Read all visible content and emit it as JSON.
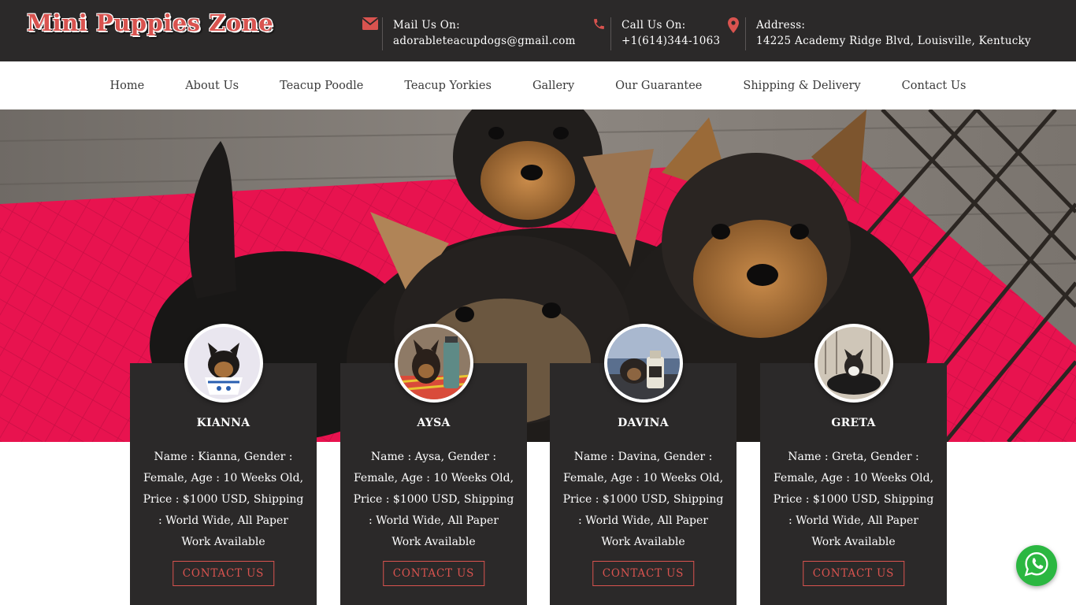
{
  "header": {
    "logo": "Mini Puppies Zone",
    "mail": {
      "label": "Mail Us On:",
      "value": "adorableteacupdogs@gmail.com",
      "icon": "envelope-icon"
    },
    "phone": {
      "label": "Call Us On:",
      "value": "+1(614)344-1063",
      "icon": "phone-icon"
    },
    "address": {
      "label": "Address:",
      "value": "14225 Academy Ridge Blvd, Louisville, Kentucky",
      "icon": "map-marker-icon"
    }
  },
  "nav": {
    "items": [
      "Home",
      "About Us",
      "Teacup Poodle",
      "Teacup Yorkies",
      "Gallery",
      "Our Guarantee",
      "Shipping & Delivery",
      "Contact Us"
    ]
  },
  "cards": [
    {
      "name": "KIANNA",
      "desc": "Name : Kianna, Gender : Female, Age : 10 Weeks Old, Price : $1000 USD, Shipping : World Wide, All Paper Work Available",
      "button": "CONTACT US"
    },
    {
      "name": "AYSA",
      "desc": "Name : Aysa, Gender : Female, Age : 10 Weeks Old, Price : $1000 USD, Shipping : World Wide, All Paper Work Available",
      "button": "CONTACT US"
    },
    {
      "name": "DAVINA",
      "desc": "Name : Davina, Gender : Female, Age : 10 Weeks Old, Price : $1000 USD, Shipping : World Wide, All Paper Work Available",
      "button": "CONTACT US"
    },
    {
      "name": "GRETA",
      "desc": "Name : Greta, Gender : Female, Age : 10 Weeks Old, Price : $1000 USD, Shipping : World Wide, All Paper Work Available",
      "button": "CONTACT US"
    }
  ],
  "colors": {
    "accent": "#d9534f",
    "dark": "#2b2929",
    "whatsapp": "#2bb741"
  },
  "floating": {
    "icon": "whatsapp-icon"
  }
}
